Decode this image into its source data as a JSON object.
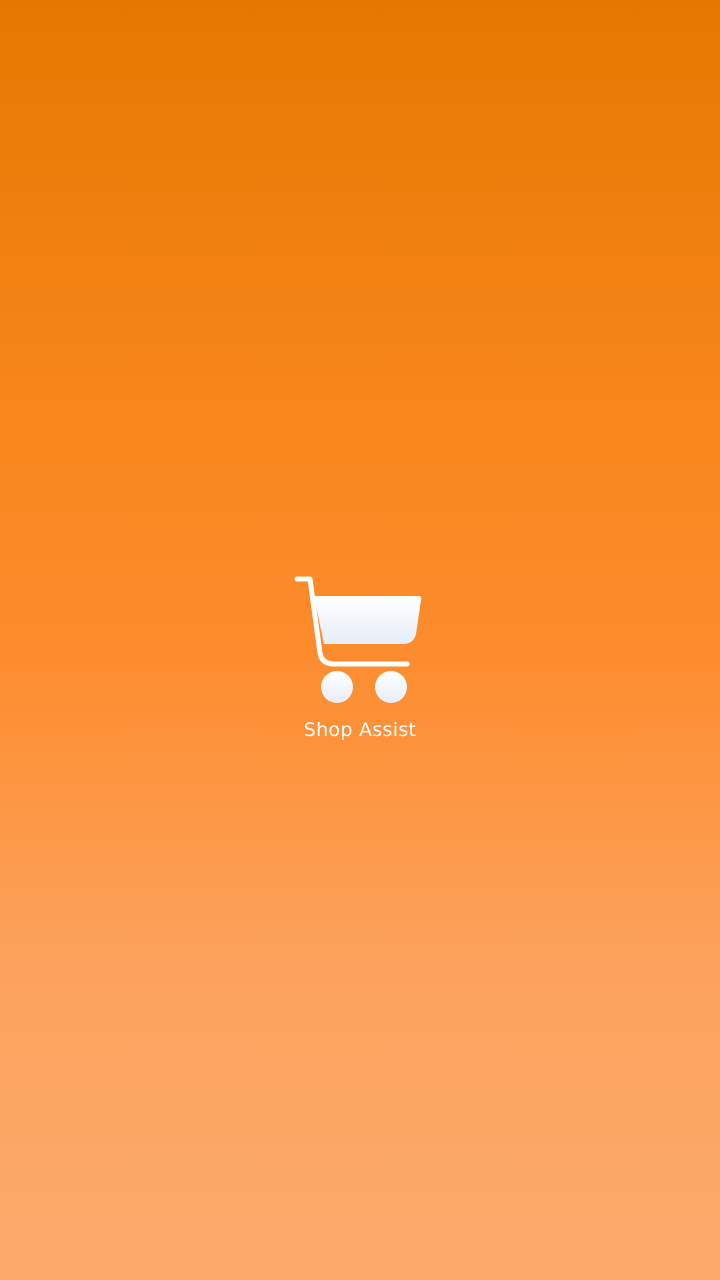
{
  "splash": {
    "app_name": "Shop Assist",
    "logo_icon": "shopping-cart-icon"
  },
  "colors": {
    "background_top": "#E67800",
    "background_middle": "#FD8B2C",
    "background_bottom": "#FBAA6C",
    "logo": "#FFFFFF",
    "text": "#FFFFFF"
  }
}
